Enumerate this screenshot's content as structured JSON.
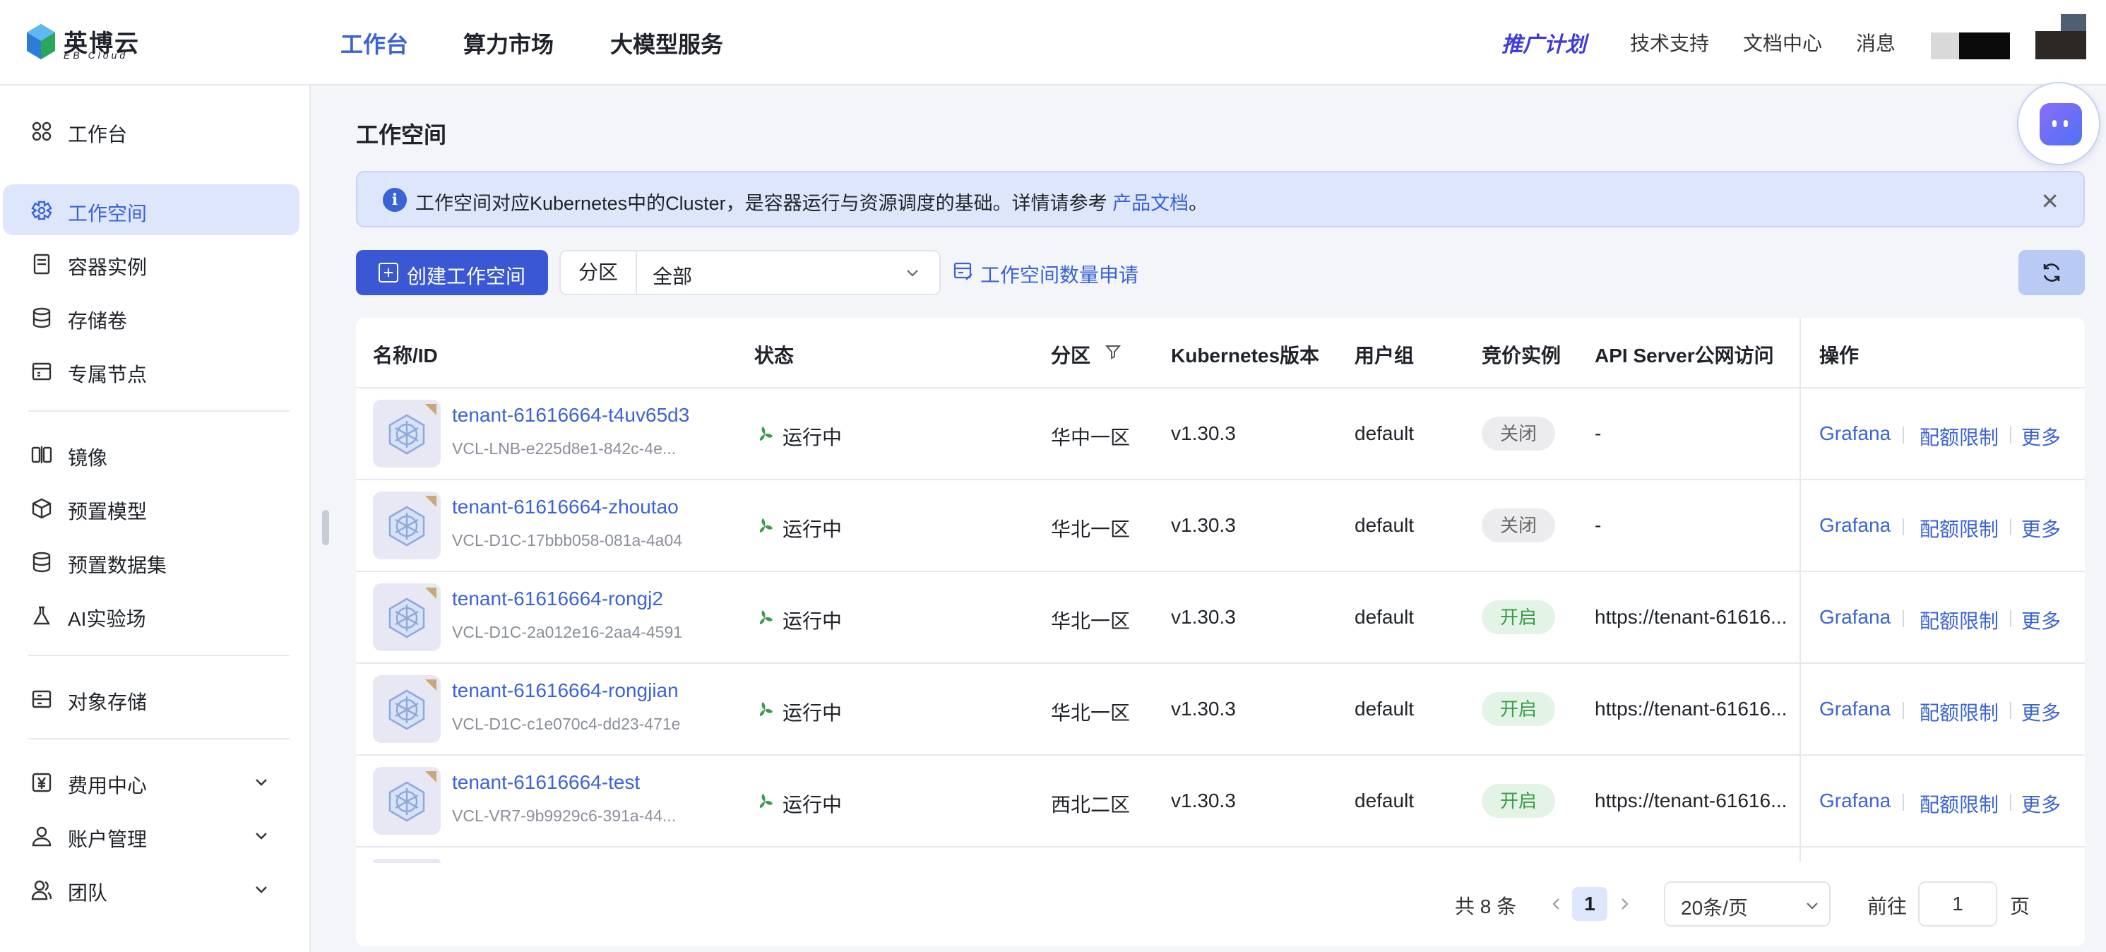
{
  "brand": {
    "name": "英博云",
    "sub": "EB Cloud"
  },
  "topnav": [
    {
      "label": "工作台",
      "active": true
    },
    {
      "label": "算力市场",
      "active": false
    },
    {
      "label": "大模型服务",
      "active": false
    }
  ],
  "promo": "推广计划",
  "toplinks": [
    "技术支持",
    "文档中心",
    "消息"
  ],
  "sidebar": {
    "items": [
      {
        "label": "工作台",
        "icon": "dashboard-icon"
      },
      {
        "label": "工作空间",
        "icon": "workspace-icon",
        "active": true
      },
      {
        "label": "容器实例",
        "icon": "container-icon"
      },
      {
        "label": "存储卷",
        "icon": "database-icon"
      },
      {
        "label": "专属节点",
        "icon": "node-icon"
      },
      {
        "label": "镜像",
        "icon": "image-icon"
      },
      {
        "label": "预置模型",
        "icon": "cube-icon"
      },
      {
        "label": "预置数据集",
        "icon": "dataset-icon"
      },
      {
        "label": "AI实验场",
        "icon": "flask-icon"
      },
      {
        "label": "对象存储",
        "icon": "bucket-icon"
      },
      {
        "label": "费用中心",
        "icon": "yen-icon",
        "expandable": true
      },
      {
        "label": "账户管理",
        "icon": "user-icon",
        "expandable": true
      },
      {
        "label": "团队",
        "icon": "team-icon",
        "expandable": true
      }
    ]
  },
  "page": {
    "title": "工作空间",
    "banner": {
      "text": "工作空间对应Kubernetes中的Cluster，是容器运行与资源调度的基础。详情请参考",
      "link": "产品文档",
      "suffix": "。"
    },
    "toolbar": {
      "create_label": "创建工作空间",
      "zone_label": "分区",
      "zone_value": "全部",
      "apply_label": "工作空间数量申请"
    }
  },
  "table": {
    "columns": [
      "名称/ID",
      "状态",
      "分区",
      "Kubernetes版本",
      "用户组",
      "竞价实例",
      "API Server公网访问",
      "操作"
    ],
    "rows": [
      {
        "name": "tenant-61616664-t4uv65d3",
        "id": "VCL-LNB-e225d8e1-842c-4e...",
        "status": "运行中",
        "zone": "华中一区",
        "k8s": "v1.30.3",
        "group": "default",
        "spot": "关闭",
        "spot_on": false,
        "api": "-"
      },
      {
        "name": "tenant-61616664-zhoutao",
        "id": "VCL-D1C-17bbb058-081a-4a04",
        "status": "运行中",
        "zone": "华北一区",
        "k8s": "v1.30.3",
        "group": "default",
        "spot": "关闭",
        "spot_on": false,
        "api": "-"
      },
      {
        "name": "tenant-61616664-rongj2",
        "id": "VCL-D1C-2a012e16-2aa4-4591",
        "status": "运行中",
        "zone": "华北一区",
        "k8s": "v1.30.3",
        "group": "default",
        "spot": "开启",
        "spot_on": true,
        "api": "https://tenant-61616..."
      },
      {
        "name": "tenant-61616664-rongjian",
        "id": "VCL-D1C-c1e070c4-dd23-471e",
        "status": "运行中",
        "zone": "华北一区",
        "k8s": "v1.30.3",
        "group": "default",
        "spot": "开启",
        "spot_on": true,
        "api": "https://tenant-61616..."
      },
      {
        "name": "tenant-61616664-test",
        "id": "VCL-VR7-9b9929c6-391a-44...",
        "status": "运行中",
        "zone": "西北二区",
        "k8s": "v1.30.3",
        "group": "default",
        "spot": "开启",
        "spot_on": true,
        "api": "https://tenant-61616..."
      }
    ],
    "actions": [
      "Grafana",
      "配额限制",
      "更多"
    ]
  },
  "pager": {
    "total": "共 8 条",
    "page": "1",
    "size": "20条/页",
    "goto_label": "前往",
    "goto_value": "1",
    "goto_unit": "页"
  },
  "colors": {
    "accent": "#3a63d6",
    "primary_button": "#3a57d4",
    "status_green": "#3a9a4a"
  }
}
